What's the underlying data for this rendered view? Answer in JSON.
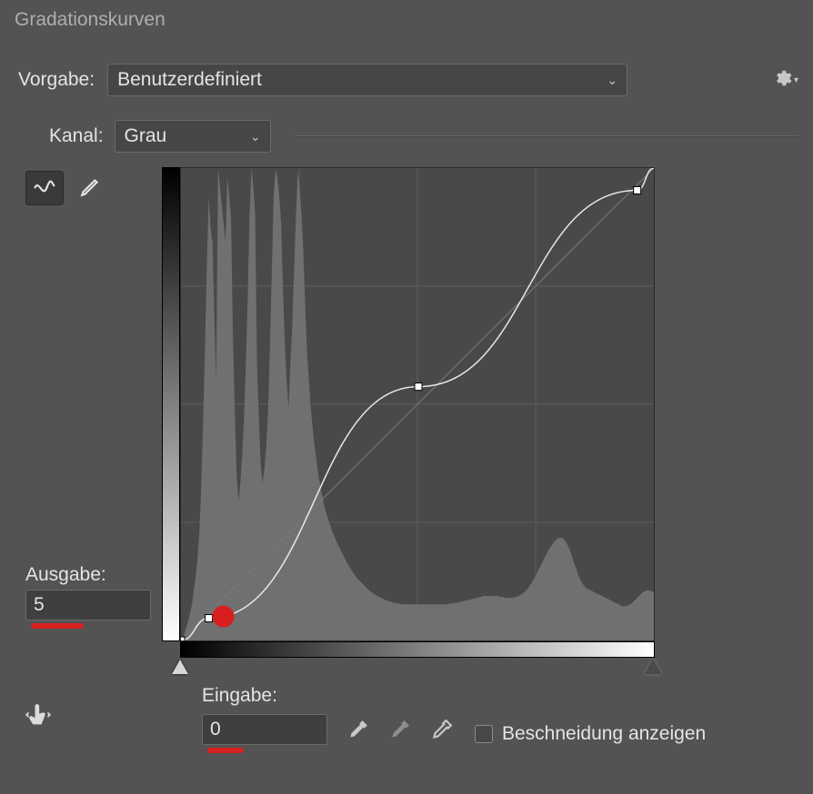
{
  "title": "Gradationskurven",
  "preset": {
    "label": "Vorgabe:",
    "value": "Benutzerdefiniert"
  },
  "channel": {
    "label": "Kanal:",
    "value": "Grau"
  },
  "output": {
    "label": "Ausgabe:",
    "value": "5"
  },
  "input": {
    "label": "Eingabe:",
    "value": "0"
  },
  "clip": {
    "label": "Beschneidung anzeigen",
    "checked": false
  },
  "sliders": {
    "black": 0,
    "white": 255
  },
  "chart_data": {
    "type": "curve",
    "xlim": [
      0,
      255
    ],
    "ylim": [
      0,
      255
    ],
    "grid": "4x4",
    "series": [
      {
        "name": "baseline",
        "points": [
          [
            0,
            0
          ],
          [
            255,
            255
          ]
        ]
      },
      {
        "name": "curve",
        "points": [
          [
            0,
            0
          ],
          [
            15,
            12
          ],
          [
            128,
            137
          ],
          [
            246,
            243
          ],
          [
            255,
            255
          ]
        ]
      }
    ],
    "control_points": [
      [
        0,
        0
      ],
      [
        15,
        12
      ],
      [
        128,
        137
      ],
      [
        246,
        243
      ]
    ],
    "selected_point": [
      15,
      12
    ],
    "histogram": [
      0,
      0,
      8,
      15,
      22,
      30,
      40,
      55,
      70,
      90,
      120,
      170,
      240,
      320,
      410,
      480,
      445,
      430,
      350,
      280,
      510,
      490,
      470,
      450,
      430,
      500,
      480,
      455,
      330,
      250,
      180,
      150,
      170,
      200,
      240,
      300,
      370,
      460,
      510,
      490,
      460,
      300,
      240,
      190,
      170,
      185,
      210,
      250,
      320,
      400,
      480,
      508,
      500,
      480,
      450,
      380,
      320,
      280,
      250,
      300,
      340,
      400,
      460,
      505,
      490,
      460,
      420,
      360,
      310,
      280,
      250,
      230,
      210,
      195,
      180,
      168,
      158,
      148,
      140,
      133,
      127,
      121,
      116,
      111,
      106,
      102,
      98,
      94,
      90,
      86,
      82,
      79,
      76,
      73,
      70,
      67,
      65,
      63,
      61,
      59,
      57,
      55,
      53,
      52,
      50,
      49,
      48,
      47,
      46,
      45,
      44,
      43,
      42,
      42,
      41,
      41,
      40,
      40,
      40,
      39,
      39,
      39,
      39,
      39,
      39,
      39,
      39,
      39,
      39,
      39,
      39,
      39,
      39,
      39,
      39,
      39,
      39,
      39,
      39,
      39,
      39,
      39,
      39,
      39,
      39,
      40,
      40,
      40,
      41,
      41,
      41,
      42,
      42,
      43,
      43,
      44,
      44,
      45,
      45,
      46,
      46,
      47,
      47,
      48,
      48,
      48,
      48,
      48,
      48,
      48,
      48,
      48,
      47,
      47,
      47,
      46,
      46,
      46,
      46,
      46,
      47,
      47,
      48,
      49,
      50,
      52,
      54,
      56,
      59,
      62,
      65,
      69,
      73,
      77,
      81,
      85,
      89,
      93,
      97,
      100,
      103,
      106,
      108,
      110,
      111,
      111,
      110,
      108,
      105,
      101,
      96,
      90,
      84,
      78,
      72,
      67,
      63,
      60,
      58,
      56,
      55,
      54,
      53,
      52,
      51,
      50,
      49,
      48,
      47,
      46,
      45,
      44,
      43,
      42,
      41,
      40,
      39,
      38,
      37,
      37,
      37,
      38,
      39,
      40,
      42,
      44,
      46,
      48,
      50,
      52,
      53,
      54,
      54,
      54,
      53,
      52
    ]
  }
}
